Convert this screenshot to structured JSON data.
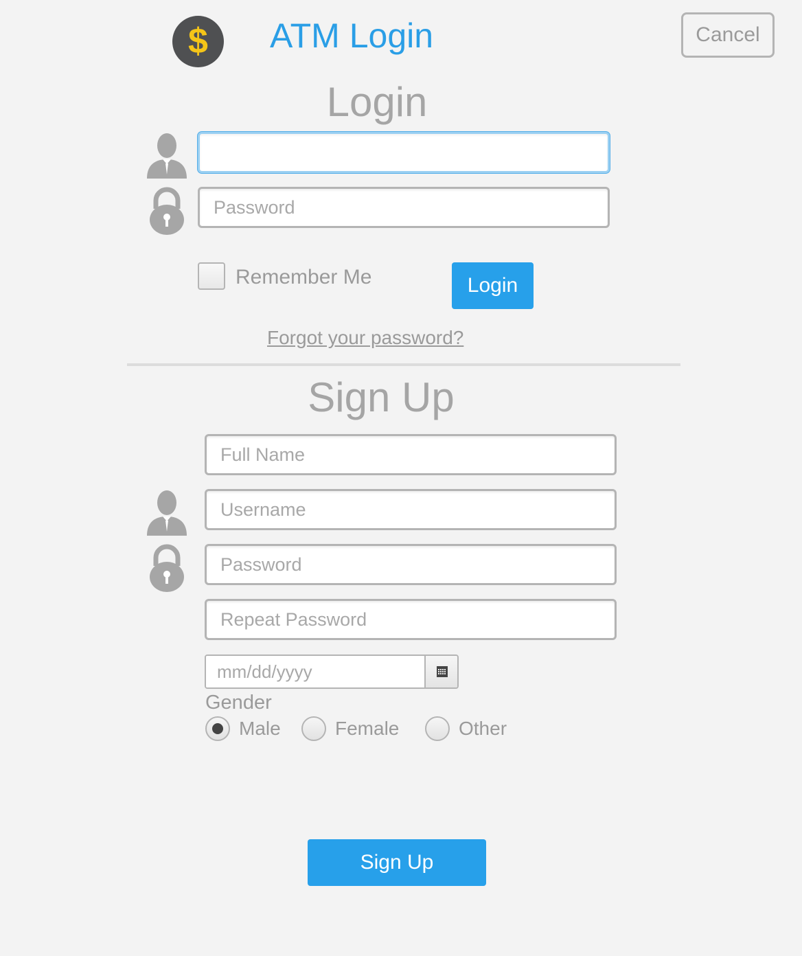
{
  "header": {
    "logo_symbol": "$",
    "title": "ATM Login",
    "cancel_label": "Cancel"
  },
  "login": {
    "title": "Login",
    "username_value": "",
    "password_placeholder": "Password",
    "remember_label": "Remember Me",
    "remember_checked": false,
    "submit_label": "Login",
    "forgot_label": "Forgot your password?"
  },
  "signup": {
    "title": "Sign Up",
    "full_name_placeholder": "Full Name",
    "username_placeholder": "Username",
    "password_placeholder": "Password",
    "repeat_password_placeholder": "Repeat Password",
    "date_placeholder": "mm/dd/yyyy",
    "gender_label": "Gender",
    "gender_options": [
      "Male",
      "Female",
      "Other"
    ],
    "gender_selected": "Male",
    "submit_label": "Sign Up"
  },
  "icons": {
    "logo": "dollar-icon",
    "user": "user-icon",
    "lock": "lock-icon",
    "calendar": "calendar-icon"
  },
  "colors": {
    "accent": "#27a0ea",
    "title": "#2a9ee6",
    "logo_bg": "#4f5052",
    "logo_fg": "#f5c518",
    "background": "#f3f3f3",
    "muted_text": "#9a9a9a"
  }
}
